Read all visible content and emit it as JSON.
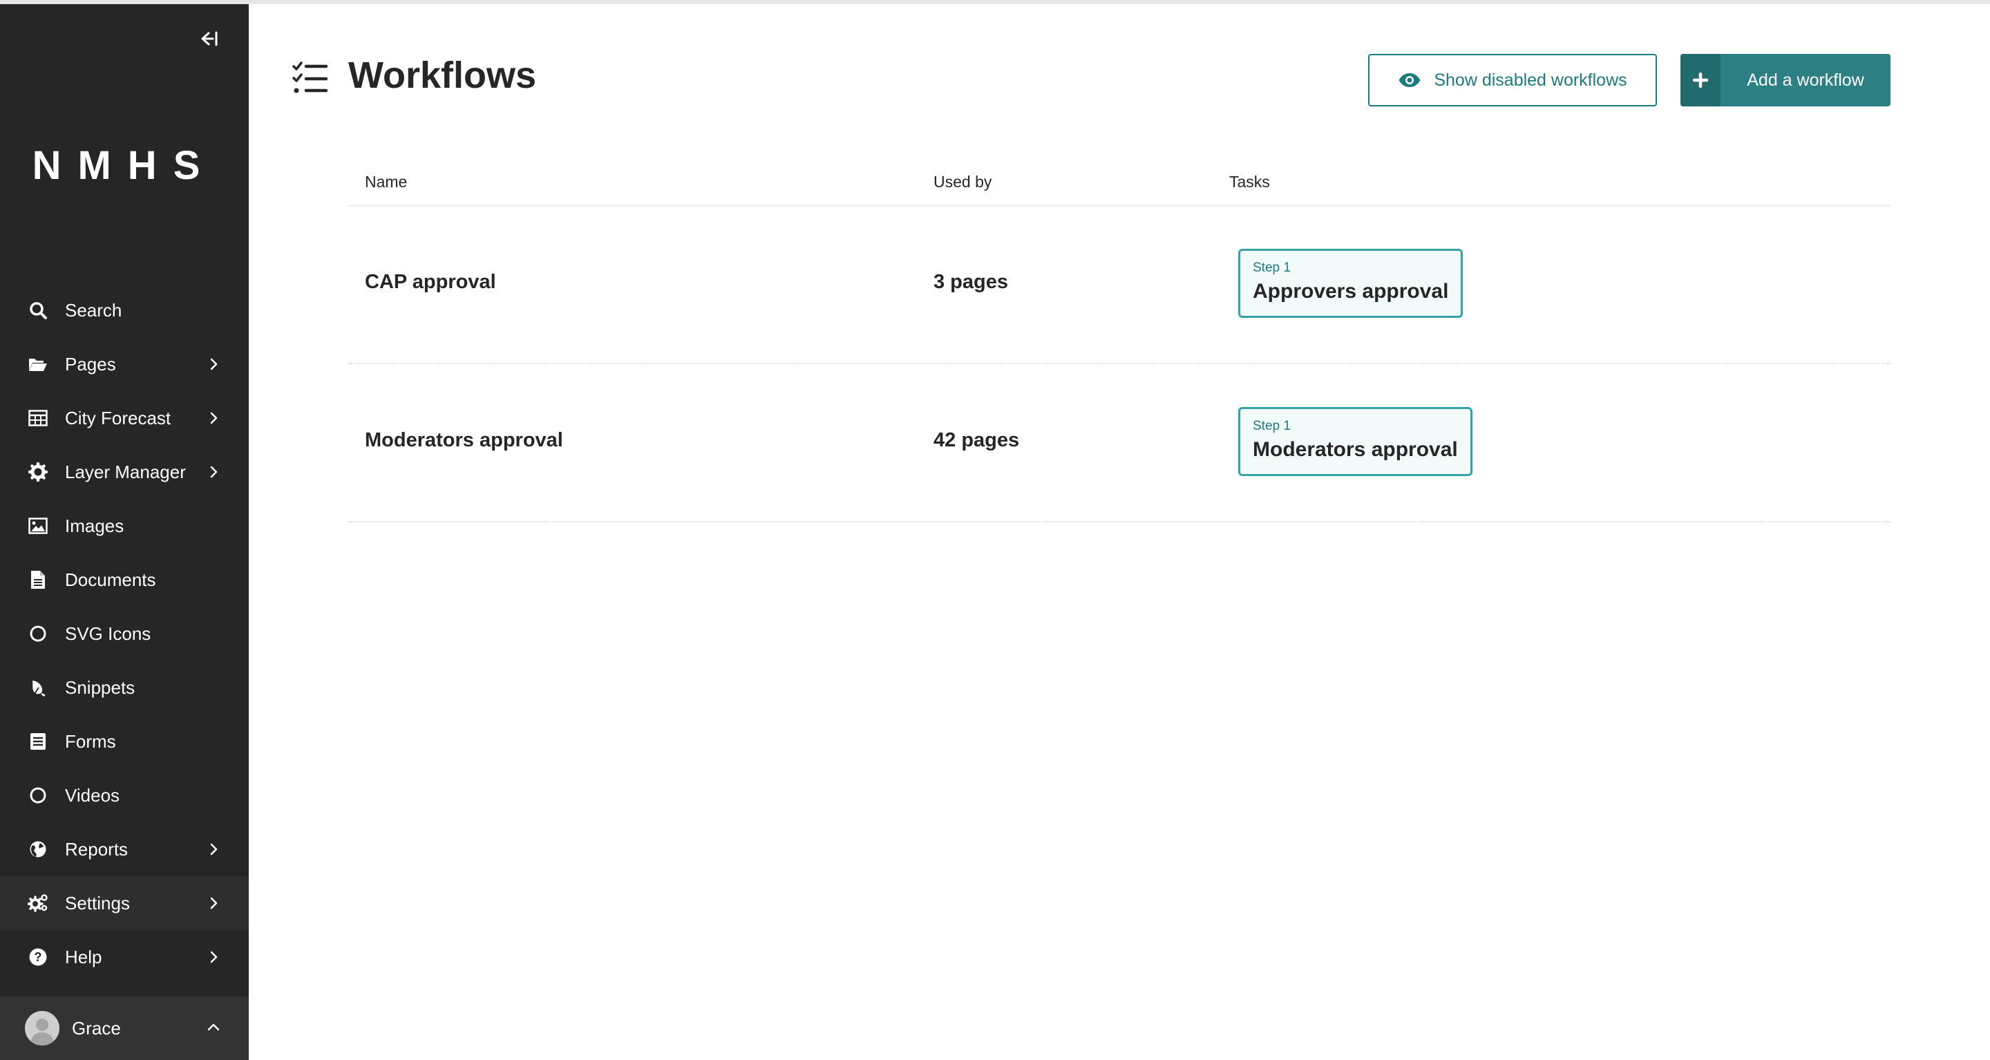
{
  "sidebar": {
    "logo": "NMHS",
    "items": [
      {
        "label": "Search",
        "icon": "search-icon",
        "has_submenu": false
      },
      {
        "label": "Pages",
        "icon": "folder-open-icon",
        "has_submenu": true
      },
      {
        "label": "City Forecast",
        "icon": "table-icon",
        "has_submenu": true
      },
      {
        "label": "Layer Manager",
        "icon": "cog-icon",
        "has_submenu": true
      },
      {
        "label": "Images",
        "icon": "image-icon",
        "has_submenu": false
      },
      {
        "label": "Documents",
        "icon": "document-icon",
        "has_submenu": false
      },
      {
        "label": "SVG Icons",
        "icon": "circle-icon",
        "has_submenu": false
      },
      {
        "label": "Snippets",
        "icon": "snippet-icon",
        "has_submenu": false
      },
      {
        "label": "Forms",
        "icon": "form-icon",
        "has_submenu": false
      },
      {
        "label": "Videos",
        "icon": "circle-icon",
        "has_submenu": false
      },
      {
        "label": "Reports",
        "icon": "globe-icon",
        "has_submenu": true
      },
      {
        "label": "Settings",
        "icon": "cogs-icon",
        "has_submenu": true
      },
      {
        "label": "Help",
        "icon": "help-icon",
        "has_submenu": true
      }
    ],
    "user": {
      "name": "Grace"
    }
  },
  "header": {
    "title": "Workflows",
    "show_disabled_label": "Show disabled workflows",
    "add_label": "Add a workflow"
  },
  "table": {
    "columns": {
      "name": "Name",
      "used_by": "Used by",
      "tasks": "Tasks"
    },
    "rows": [
      {
        "name": "CAP approval",
        "used_by": "3 pages",
        "task_step": "Step 1",
        "task_name": "Approvers approval"
      },
      {
        "name": "Moderators approval",
        "used_by": "42 pages",
        "task_step": "Step 1",
        "task_name": "Moderators approval"
      }
    ]
  },
  "colors": {
    "accent": "#2c7f82",
    "sidebar": "#262626"
  }
}
